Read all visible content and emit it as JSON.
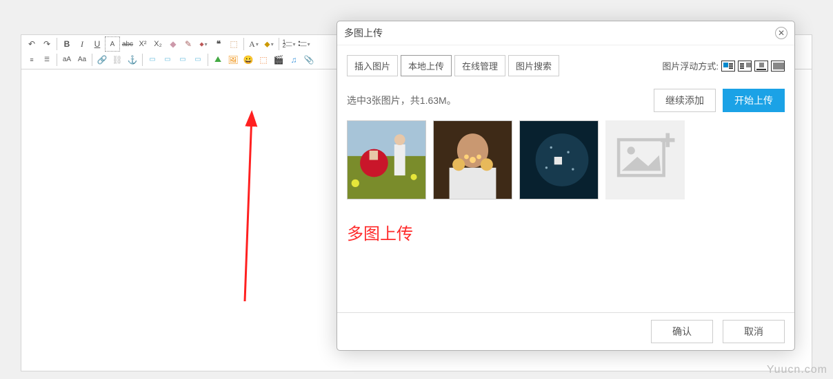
{
  "toolbar": {
    "icons": [
      "↶",
      "↷",
      "B",
      "I",
      "U",
      "A̶",
      "abc",
      "X²",
      "X₂",
      "◆",
      "✎",
      "⬥",
      "❝",
      "⬚",
      "A",
      "⬥",
      "list1",
      "list2",
      "⬛",
      "⬛",
      "A",
      "A",
      "🔗",
      "⛓",
      "⚓",
      "↤",
      "↔",
      "↦",
      "⬛",
      "⬛",
      "🖼",
      "😀",
      "⬛",
      "🎬",
      "♫",
      "📎"
    ]
  },
  "dialog": {
    "title": "多图上传",
    "tabs": [
      "插入图片",
      "本地上传",
      "在线管理",
      "图片搜索"
    ],
    "active_tab": 1,
    "float_label": "图片浮动方式:",
    "status": "选中3张图片，共1.63M。",
    "btn_continue": "继续添加",
    "btn_upload": "开始上传",
    "big_label": "多图上传",
    "btn_ok": "确认",
    "btn_cancel": "取消"
  },
  "watermark": "Yuucn.com"
}
